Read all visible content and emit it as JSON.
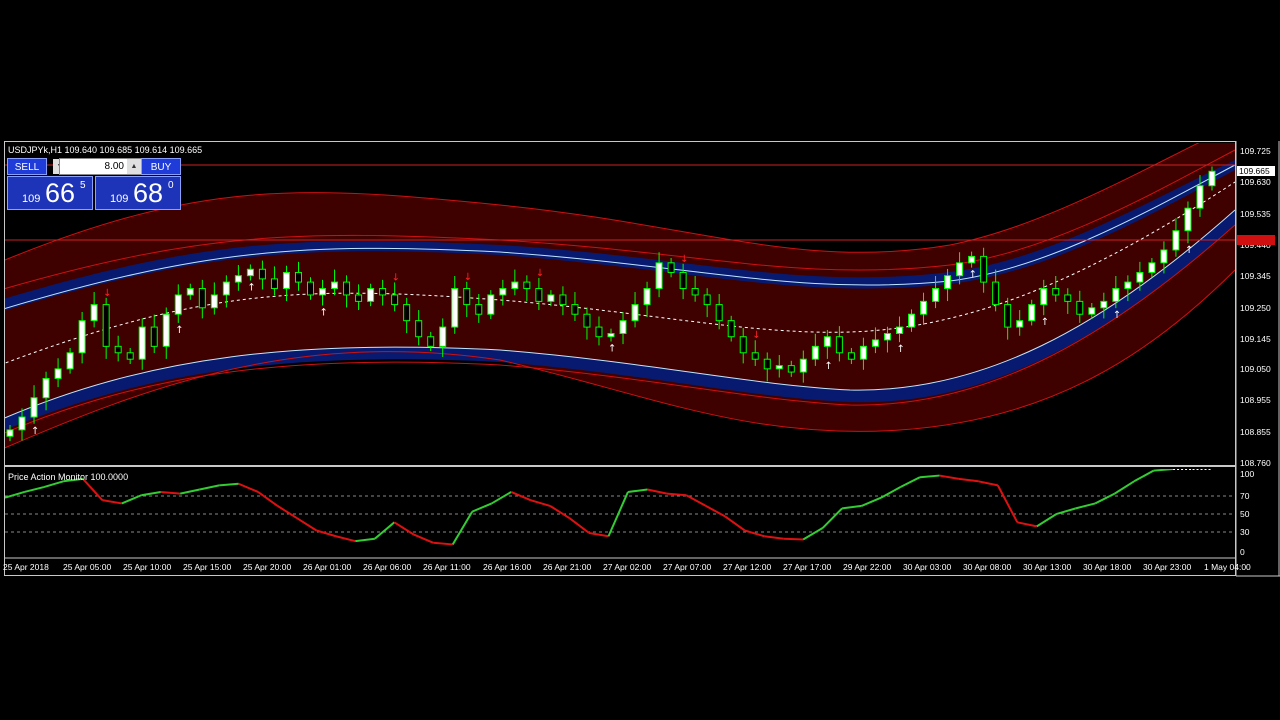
{
  "header": {
    "symbol_info": "USDJPYk,H1  109.640 109.685 109.614 109.665"
  },
  "trade_panel": {
    "sell_label": "SELL",
    "buy_label": "BUY",
    "lot_value": "8.00",
    "sell_prefix": "109",
    "sell_big": "66",
    "sell_sup": "5",
    "buy_prefix": "109",
    "buy_big": "68",
    "buy_sup": "0"
  },
  "price_axis": [
    "109.725",
    "109.630",
    "109.535",
    "109.440",
    "109.345",
    "109.250",
    "109.145",
    "109.050",
    "108.955",
    "108.855",
    "108.760"
  ],
  "current_price": "109.665",
  "red_line_price": "109.460",
  "indicator": {
    "title": "Price Action Monitor 100.0000",
    "levels": [
      "100",
      "70",
      "50",
      "30",
      "0"
    ]
  },
  "time_axis": [
    "25 Apr 2018",
    "25 Apr 05:00",
    "25 Apr 10:00",
    "25 Apr 15:00",
    "25 Apr 20:00",
    "26 Apr 01:00",
    "26 Apr 06:00",
    "26 Apr 11:00",
    "26 Apr 16:00",
    "26 Apr 21:00",
    "27 Apr 02:00",
    "27 Apr 07:00",
    "27 Apr 12:00",
    "27 Apr 17:00",
    "29 Apr 22:00",
    "30 Apr 03:00",
    "30 Apr 08:00",
    "30 Apr 13:00",
    "30 Apr 18:00",
    "30 Apr 23:00",
    "1 May 04:00"
  ],
  "colors": {
    "bull": "#ffffff",
    "bear": "#000000",
    "wick": "#00ff00",
    "band_outer": "#5a0000",
    "band_inner": "#0a1a66",
    "rsi_up": "#33cc33",
    "rsi_down": "#dd1111"
  },
  "chart_data": {
    "type": "candlestick",
    "symbol": "USDJPYk,H1",
    "ylim": [
      108.76,
      109.725
    ],
    "close": [
      108.86,
      108.9,
      108.96,
      109.02,
      109.05,
      109.1,
      109.2,
      109.25,
      109.12,
      109.1,
      109.08,
      109.18,
      109.12,
      109.22,
      109.28,
      109.3,
      109.24,
      109.28,
      109.32,
      109.34,
      109.36,
      109.33,
      109.3,
      109.35,
      109.32,
      109.28,
      109.3,
      109.32,
      109.28,
      109.26,
      109.3,
      109.28,
      109.25,
      109.2,
      109.15,
      109.12,
      109.18,
      109.3,
      109.25,
      109.22,
      109.28,
      109.3,
      109.32,
      109.3,
      109.26,
      109.28,
      109.25,
      109.22,
      109.18,
      109.15,
      109.16,
      109.2,
      109.25,
      109.3,
      109.38,
      109.35,
      109.3,
      109.28,
      109.25,
      109.2,
      109.15,
      109.1,
      109.08,
      109.05,
      109.06,
      109.04,
      109.08,
      109.12,
      109.15,
      109.1,
      109.08,
      109.12,
      109.14,
      109.16,
      109.18,
      109.22,
      109.26,
      109.3,
      109.34,
      109.38,
      109.4,
      109.32,
      109.25,
      109.18,
      109.2,
      109.25,
      109.3,
      109.28,
      109.26,
      109.22,
      109.24,
      109.26,
      109.3,
      109.32,
      109.35,
      109.38,
      109.42,
      109.48,
      109.55,
      109.62,
      109.665
    ],
    "series": [
      {
        "name": "Price Action Monitor 100.0000",
        "values": [
          65,
          72,
          78,
          85,
          88,
          62,
          58,
          68,
          72,
          70,
          75,
          80,
          82,
          72,
          55,
          40,
          25,
          18,
          12,
          15,
          35,
          20,
          10,
          8,
          48,
          58,
          72,
          62,
          55,
          40,
          22,
          18,
          72,
          75,
          70,
          68,
          55,
          42,
          25,
          18,
          15,
          14,
          28,
          52,
          55,
          65,
          78,
          90,
          92,
          88,
          85,
          80,
          35,
          30,
          45,
          52,
          58,
          70,
          85,
          98,
          100,
          100,
          100
        ]
      }
    ]
  }
}
